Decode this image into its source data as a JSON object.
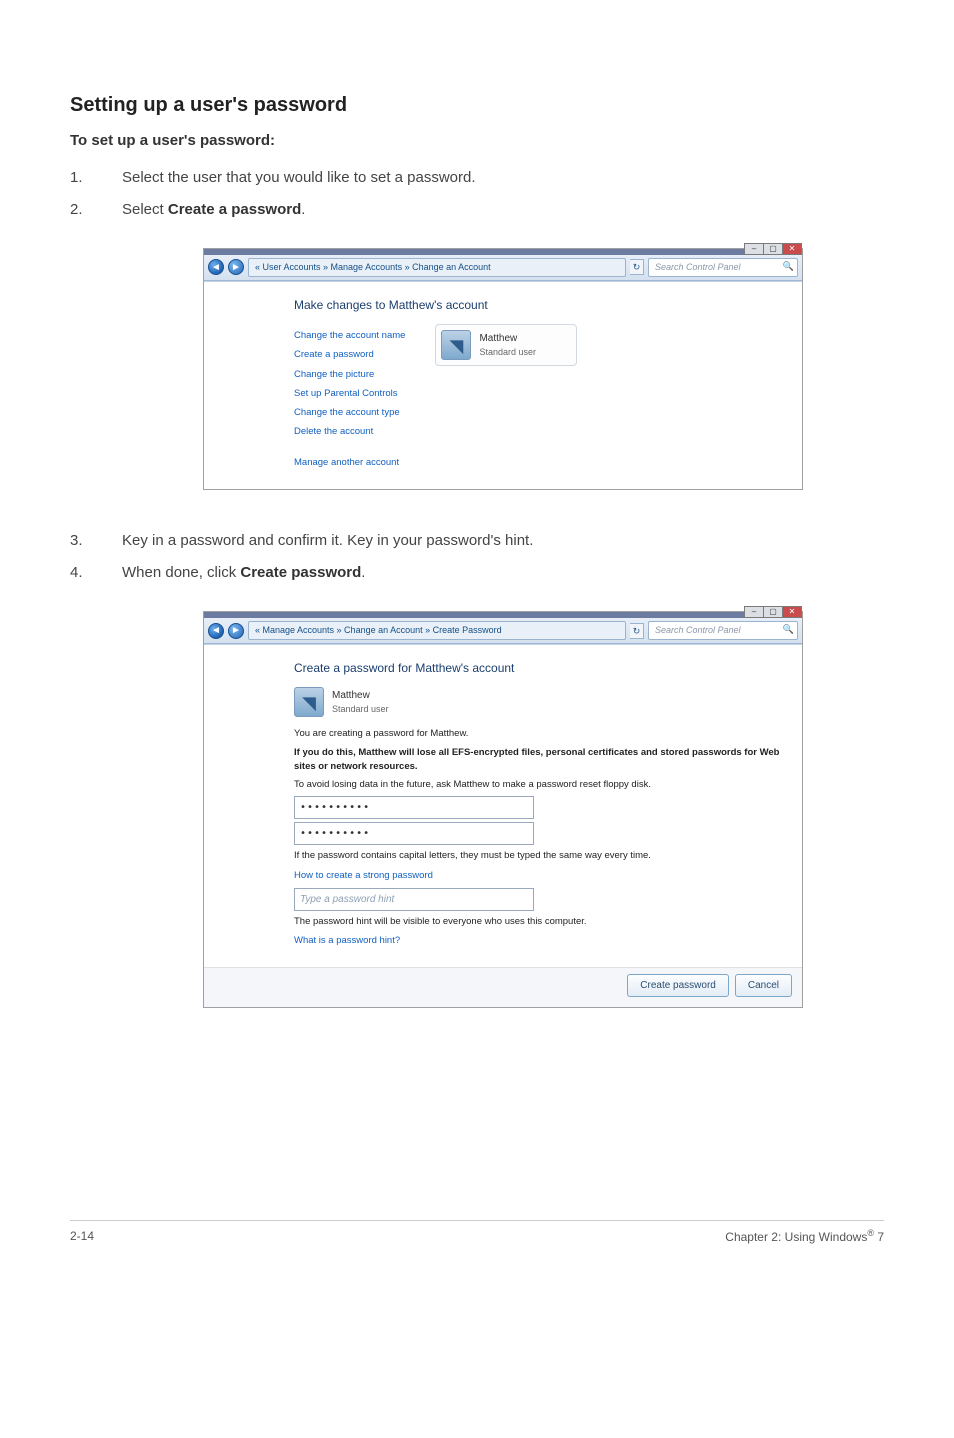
{
  "heading": "Setting up a user's password",
  "subheading": "To set up a user's password:",
  "steps_a": [
    "Select the user that you would like to set a password.",
    [
      "Select ",
      "Create a password",
      "."
    ]
  ],
  "steps_b": [
    "Key in a password and confirm it. Key in your password's hint.",
    [
      "When done, click ",
      "Create password",
      "."
    ]
  ],
  "shot1": {
    "breadcrumb": "« User Accounts » Manage Accounts » Change an Account",
    "search_placeholder": "Search Control Panel",
    "title": "Make changes to Matthew's account",
    "links": [
      "Change the account name",
      "Create a password",
      "Change the picture",
      "Set up Parental Controls",
      "Change the account type",
      "Delete the account"
    ],
    "links_footer": "Manage another account",
    "user": {
      "name": "Matthew",
      "role": "Standard user"
    }
  },
  "shot2": {
    "breadcrumb": "« Manage Accounts » Change an Account » Create Password",
    "search_placeholder": "Search Control Panel",
    "title": "Create a password for Matthew's account",
    "user": {
      "name": "Matthew",
      "role": "Standard user"
    },
    "line_creating": "You are creating a password for Matthew.",
    "line_warn": "If you do this, Matthew will lose all EFS-encrypted files, personal certificates and stored passwords for Web sites or network resources.",
    "line_avoid": "To avoid losing data in the future, ask Matthew to make a password reset floppy disk.",
    "pw1": "••••••••••",
    "pw2": "••••••••••",
    "hint_caps": "If the password contains capital letters, they must be typed the same way every time.",
    "hint_link": "How to create a strong password",
    "hint_placeholder": "Type a password hint",
    "hint_visible": "The password hint will be visible to everyone who uses this computer.",
    "hint_what": "What is a password hint?",
    "btn_create": "Create password",
    "btn_cancel": "Cancel"
  },
  "footer": {
    "left": "2-14",
    "right_a": "Chapter 2: Using Windows",
    "right_b": " 7"
  }
}
